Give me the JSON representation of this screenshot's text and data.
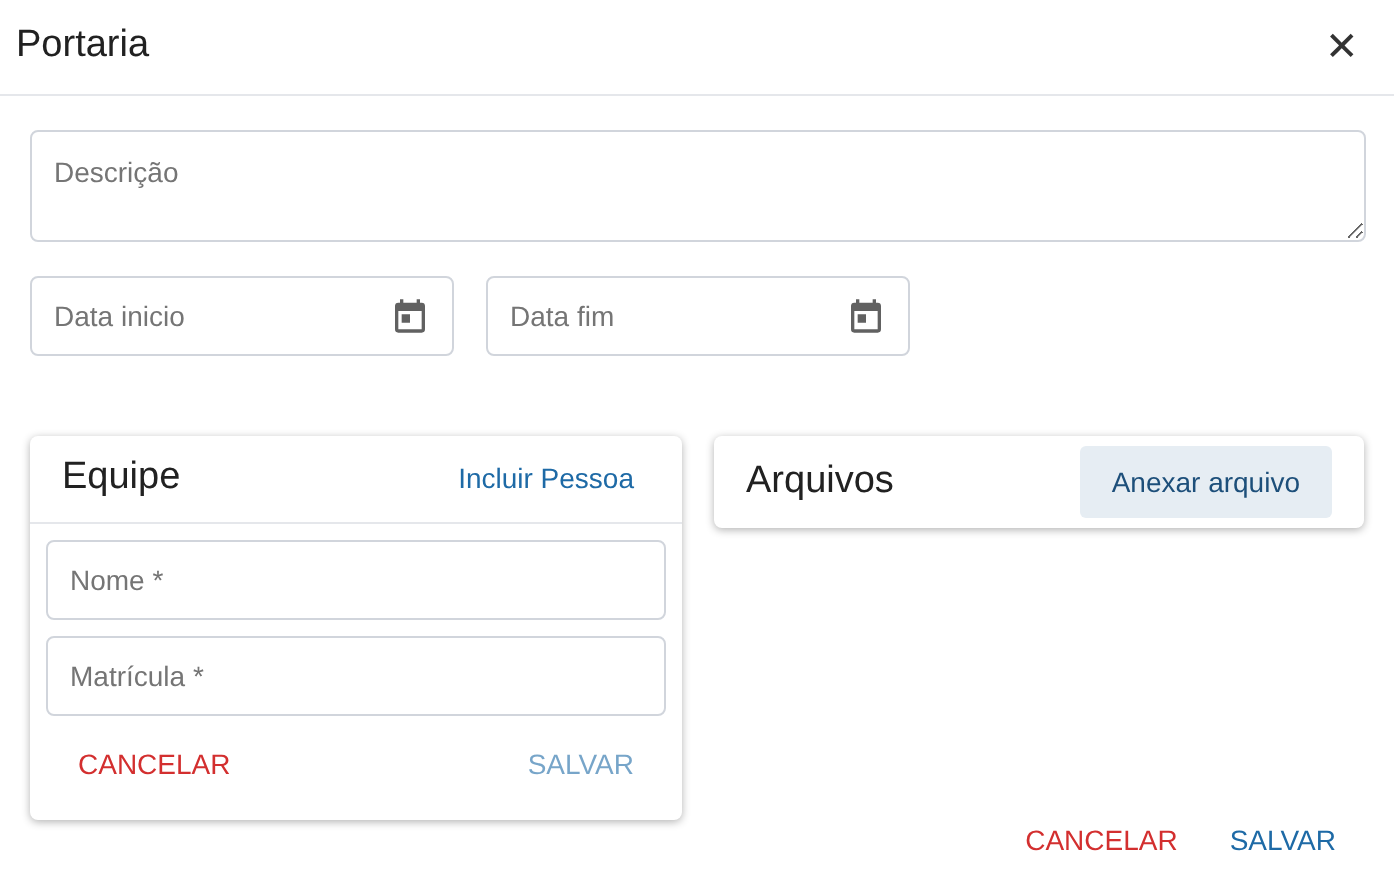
{
  "dialog": {
    "title": "Portaria",
    "close": "✕"
  },
  "description": {
    "placeholder": "Descrição"
  },
  "dates": [
    {
      "placeholder": "Data inicio"
    },
    {
      "placeholder": "Data fim"
    }
  ],
  "team_card": {
    "title": "Equipe",
    "action": "Incluir Pessoa",
    "fields": [
      {
        "placeholder": "Nome *"
      },
      {
        "placeholder": "Matrícula *"
      }
    ],
    "buttons": [
      {
        "label": "CANCELAR",
        "kind": "cancel",
        "disabled": false
      },
      {
        "label": "SALVAR",
        "kind": "save",
        "disabled": true
      }
    ]
  },
  "files_card": {
    "title": "Arquivos",
    "action": "Anexar arquivo"
  },
  "buttons": [
    {
      "label": "CANCELAR",
      "kind": "cancel",
      "disabled": false
    },
    {
      "label": "SALVAR",
      "kind": "save",
      "disabled": false
    }
  ]
}
